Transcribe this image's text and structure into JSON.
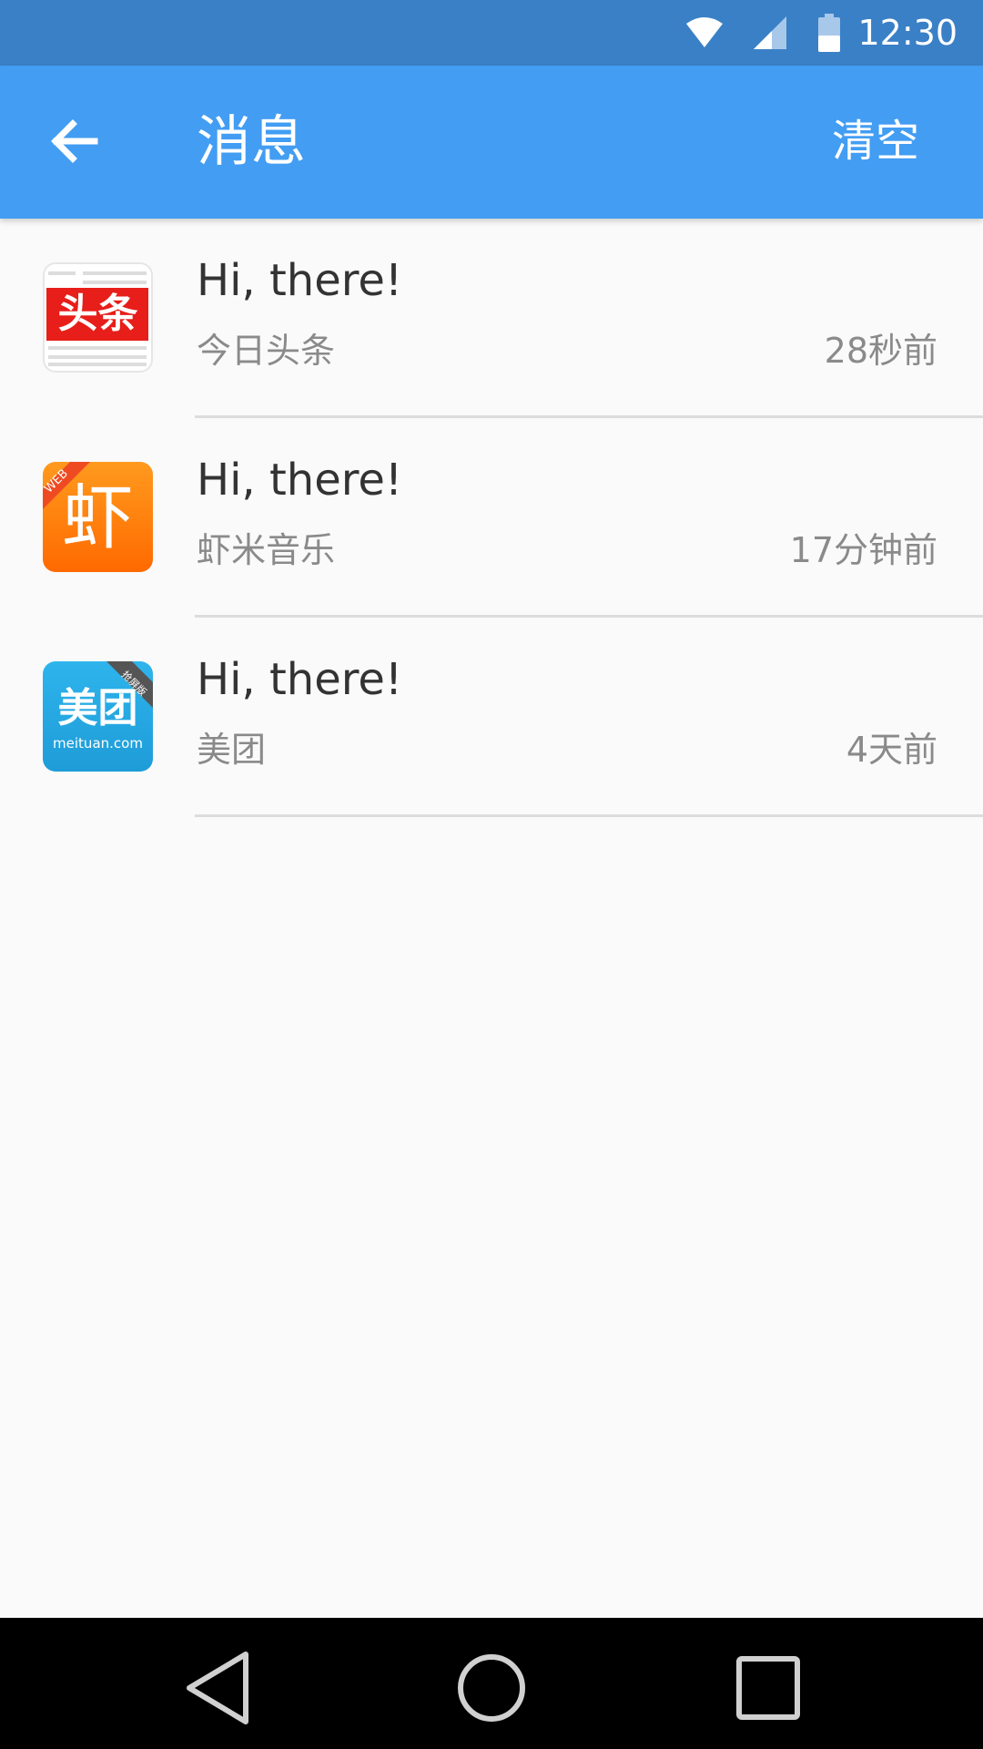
{
  "status_bar": {
    "time": "12:30"
  },
  "app_bar": {
    "title": "消息",
    "clear_label": "清空"
  },
  "messages": [
    {
      "message": "Hi, there!",
      "app": "今日头条",
      "time": "28秒前",
      "icon": "toutiao-app-icon",
      "icon_text": "头条"
    },
    {
      "message": "Hi, there!",
      "app": "虾米音乐",
      "time": "17分钟前",
      "icon": "xiami-app-icon",
      "icon_text": "虾",
      "icon_badge": "WEB"
    },
    {
      "message": "Hi, there!",
      "app": "美团",
      "time": "4天前",
      "icon": "meituan-app-icon",
      "icon_text": "美团",
      "icon_subtext": "meituan.com",
      "icon_badge": "抢屏版"
    }
  ],
  "nav_bar": {
    "buttons": [
      "back-nav",
      "home-nav",
      "recents-nav"
    ]
  },
  "colors": {
    "status_bar": "#3a80c6",
    "app_bar": "#429df3",
    "background": "#fafafa"
  }
}
